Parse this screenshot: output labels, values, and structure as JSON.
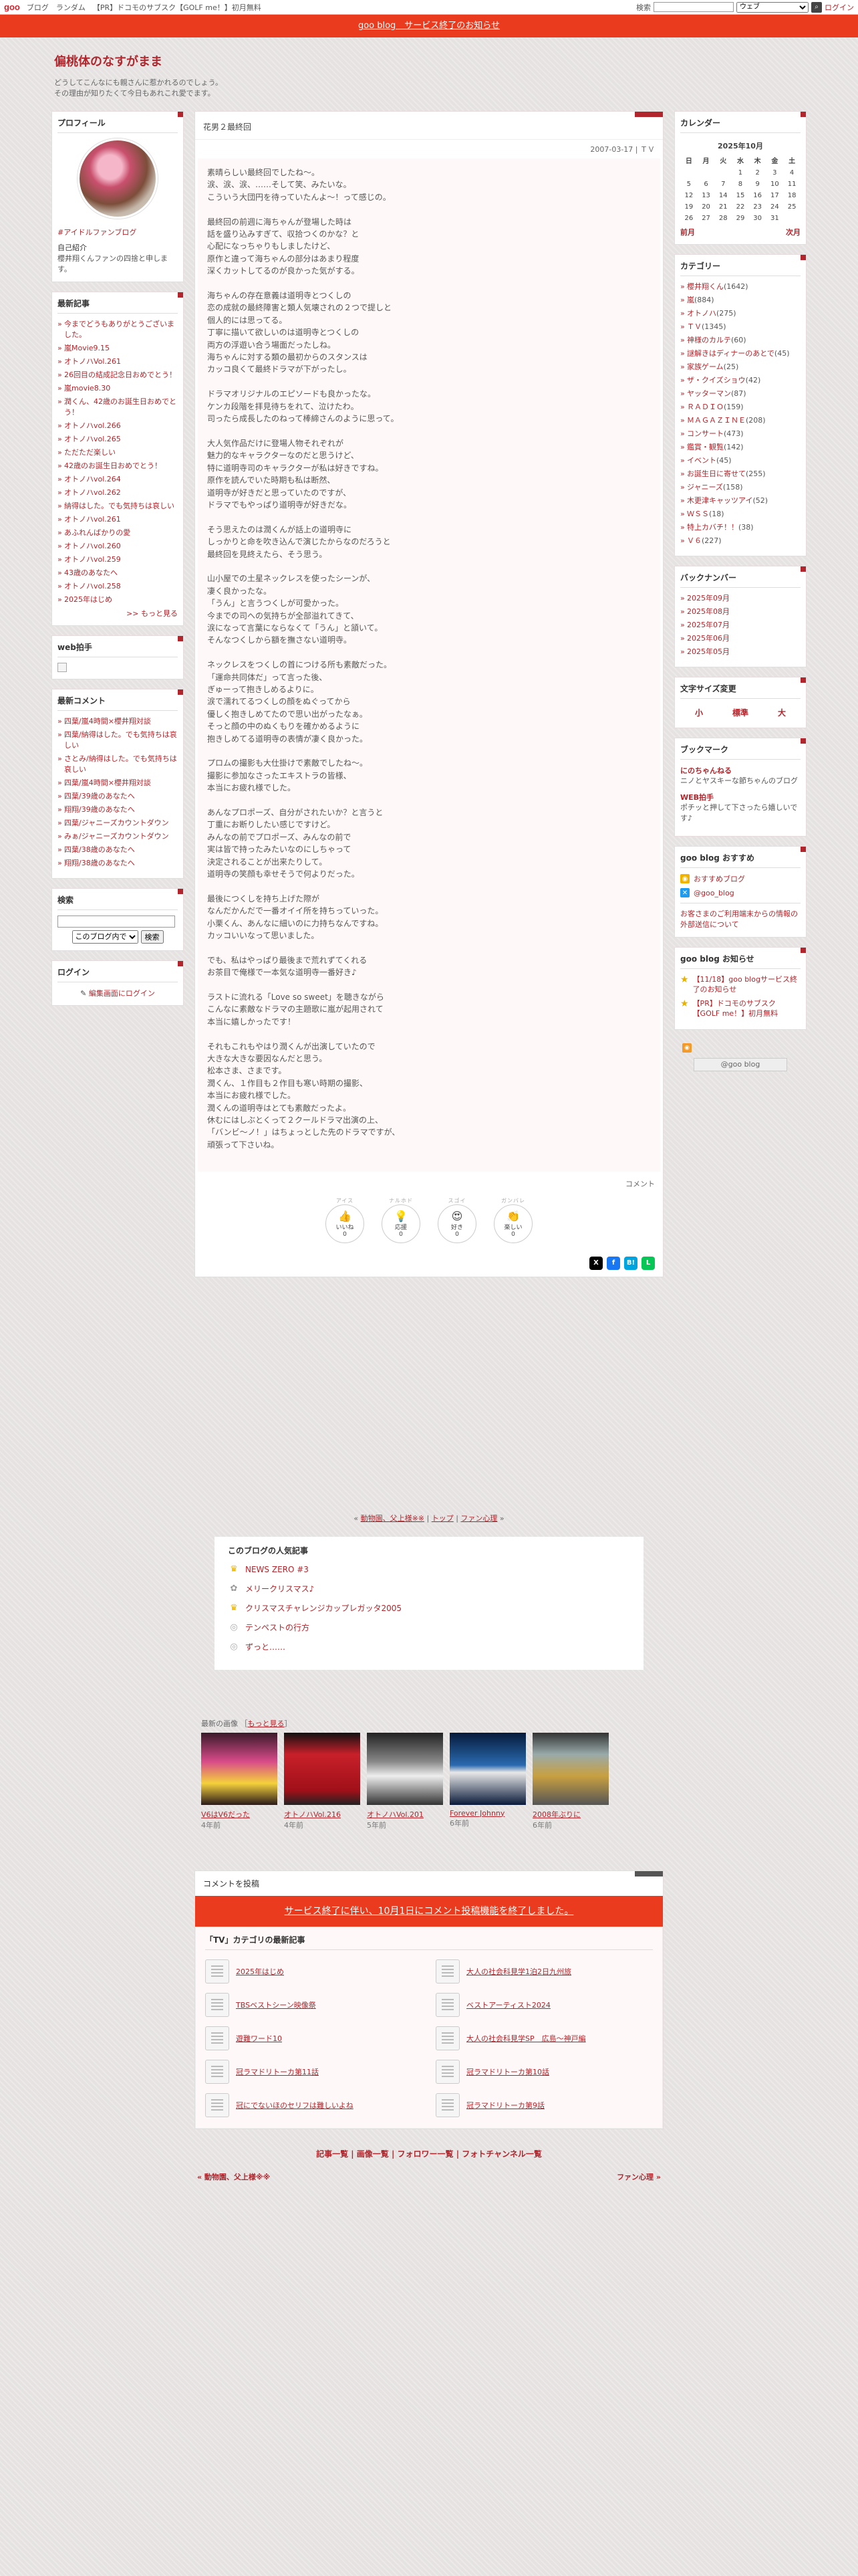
{
  "topbar": {
    "logo": "goo",
    "nav": [
      "ブログ",
      "ランダム",
      "【PR】ドコモのサブスク【GOLF me！】初月無料"
    ],
    "search_label": "検索",
    "select": "ウェブ",
    "login": "ログイン"
  },
  "notice": "goo blog　サービス終了のお知らせ",
  "header": {
    "title": "偏桃体のなすがまま",
    "desc1": "どうしてこんなにも親さんに惹かれるのでしょう。",
    "desc2": "その理由が知りたくて今日もあれこれ愛でます。"
  },
  "profile": {
    "title": "プロフィール",
    "link": "#アイドルファンブログ",
    "intro_label": "自己紹介",
    "intro": "櫻井翔くんファンの四捨と申します。"
  },
  "recent": {
    "title": "最新記事",
    "items": [
      "今までどうもありがとうございました。",
      "嵐Movie9.15",
      "オトノハVol.261",
      "26回目の結成記念日おめでとう！",
      "嵐movie8.30",
      "潤くん、42歳のお誕生日おめでとう！",
      "オトノハvol.266",
      "オトノハvol.265",
      "ただただ楽しい",
      "42歳のお誕生日おめでとう！",
      "オトノハvol.264",
      "オトノハvol.262",
      "納得はした。でも気持ちは哀しい",
      "オトノハvol.261",
      "あふれんばかりの愛",
      "オトノハvol.260",
      "オトノハvol.259",
      "43歳のあなたへ",
      "オトノハvol.258",
      "2025年はじめ"
    ],
    "more": ">> もっと見る"
  },
  "webclap": {
    "title": "web拍手"
  },
  "latest_comments": {
    "title": "最新コメント",
    "items": [
      "四葉/嵐4時間×櫻井翔対談",
      "四葉/納得はした。でも気持ちは哀しい",
      "さとみ/納得はした。でも気持ちは哀しい",
      "四葉/嵐4時間×櫻井翔対談",
      "四葉/39歳のあなたへ",
      "翔翔/39歳のあなたへ",
      "四葉/ジャニーズカウントダウン",
      "みぁ/ジャニーズカウントダウン",
      "四葉/38歳のあなたへ",
      "翔翔/38歳のあなたへ"
    ]
  },
  "search": {
    "title": "検索",
    "select": "このブログ内で",
    "button": "検索"
  },
  "login": {
    "title": "ログイン",
    "link": "編集画面にログイン"
  },
  "article": {
    "title": "花男２最終回",
    "date": "2007-03-17 | ＴＶ",
    "paragraphs": [
      "素晴らしい最終回でしたね〜。\n涙、涙、涙、……そして笑、みたいな。\nこういう大団円を待っていたんよ〜！って感じの。",
      "最終回の前週に海ちゃんが登場した時は\n話を盛り込みすぎて、収拾つくのかな？と\n心配になっちゃりもしましたけど、\n原作と違って海ちゃんの部分はあまり程度\n深くカットしてるのが良かった気がする。",
      "海ちゃんの存在意義は道明寺とつくしの\n恋の成就の最終障害と類人気壊されの２つで提しと\n個人的には思ってる。\n丁寧に描いて欲しいのは道明寺とつくしの\n両方の浮遊い合う場面だったしね。\n海ちゃんに対する類の最初からのスタンスは\nカッコ良くて最終ドラマが下がったし。",
      "ドラマオリジナルのエピソードも良かったな。\nケンカ段階を拝見待ちをれて、泣けたわ。\n司ったら成長したのねって棒締さんのように思って。",
      "大人気作品だけに登場人物それぞれが\n魅力的なキャラクターなのだと思うけど、\n特に道明寺司のキャラクターが私は好きですね。\n原作を読んでいた時期も私は断然、\n道明寺が好きだと思っていたのですが、\nドラマでもやっぱり道明寺が好きだな。",
      "そう思えたのは潤くんが話上の道明寺に\nしっかりと命を吹き込んで演じたからなのだろうと\n最終回を見終えたら、そう思う。",
      "山小屋での土星ネックレスを使ったシーンが、\n凄く良かったな。\n「うん」と言うつくしが可愛かった。\n今までの司への気持ちが全部溢れてきて、\n涙になって言葉にならなくて「うん」と頷いて。\nそんなつくしから額を撫さない道明寺。",
      "ネックレスをつくしの首につける所も素敵だった。\n「運命共同体だ」って言った後、\nぎゅーって抱きしめるよりに。\n涙で濡れてるつくしの顔をぬぐってから\n優しく抱きしめてたので思い出がったなぁ。\nそっと顔の中のぬくもりを確かめるように\n抱きしめてる道明寺の表情が凄く良かった。",
      "プロムの撮影も大仕掛けで素敵でしたね〜。\n撮影に参加なさったエキストラの皆様、\n本当にお疲れ様でした。",
      "あんなプロポーズ、自分がされたいか？と言うと\n丁重にお断りしたい感じですけど。\nみんなの前でプロポーズ、みんなの前で\n実は皆で持ったみたいなのにしちゃって\n決定されることが出来たりして。\n道明寺の笑顔も幸せそうで何よりだった。",
      "最後につくしを持ち上げた際が\nなんだかんだで一番オイイ所を持ちっていった。\n小栗くん、あんなに細いのに力持ちなんですね。\nカッコいいなって思いました。",
      "でも、私はやっぱり最後まで荒れずてくれる\nお茶目で俺様で一本気な道明寺一番好き♪",
      "ラストに流れる「Love so sweet」を聴きながら\nこんなに素敵なドラマの主題歌に嵐が起用されて\n本当に嬉しかったです！",
      "それもこれもやはり潤くんが出演していたので\n大きな大きな要因なんだと思う。\n松本さま、さまです。\n潤くん、１作目も２作目も寒い時期の撮影、\n本当にお疲れ様でした。\n潤くんの道明寺はとても素敵だったよ。\n休むにはしぶとくって２クールドラマ出演の上、\n「バンビ〜ノ！」はちょっとした先のドラマですが、\n頑張って下さいね。"
    ],
    "comment_label": "コメント",
    "reactions": [
      {
        "top": "アイス",
        "e": "👍",
        "lbl": "いいね",
        "n": "0"
      },
      {
        "top": "ナルホド",
        "e": "💡",
        "lbl": "応援",
        "n": "0"
      },
      {
        "top": "スゴイ",
        "e": "😍",
        "lbl": "好き",
        "n": "0"
      },
      {
        "top": "ガンバレ",
        "e": "👏",
        "lbl": "楽しい",
        "n": "0"
      }
    ]
  },
  "pager": {
    "prev": "動物園、父上様※※",
    "top": "トップ",
    "next": "ファン心理"
  },
  "popular": {
    "title": "このブログの人気記事",
    "items": [
      "NEWS ZERO #3",
      "メリークリスマス♪",
      "クリスマスチャレンジカップレガッタ2005",
      "テンペストの行方",
      "ずっと……"
    ]
  },
  "images": {
    "header": "最新の画像",
    "more": "もっと見る",
    "items": [
      {
        "cap": "V6はV6だった",
        "age": "4年前"
      },
      {
        "cap": "オトノハVol.216",
        "age": "4年前"
      },
      {
        "cap": "オトノハVol.201",
        "age": "5年前"
      },
      {
        "cap": "Forever Johnny",
        "age": "6年前"
      },
      {
        "cap": "2008年ぶりに",
        "age": "6年前"
      }
    ]
  },
  "comment_post": {
    "title": "コメントを投稿",
    "notice": "サービス終了に伴い、10月1日にコメント投稿機能を終了しました。"
  },
  "cat_latest": {
    "title": "「TV」カテゴリの最新記事",
    "items": [
      "2025年はじめ",
      "大人の社会科見学1泊2日九州旅",
      "TBSベストシーン映像祭",
      "ベストアーティスト2024",
      "遊難ワード10",
      "大人の社会科見学SP　広島〜神戸編",
      "冠ラマドリトーカ第11話",
      "冠ラマドリトーカ第10話",
      "冠にでないほのセリフは難しいよね",
      "冠ラマドリトーカ第9話"
    ]
  },
  "footer": {
    "links": "記事一覧 | 画像一覧 | フォロワー一覧 | フォトチャンネル一覧",
    "prev": "« 動物園、父上様※※",
    "next": "ファン心理 »"
  },
  "calendar": {
    "title": "カレンダー",
    "month": "2025年10月",
    "dows": [
      "日",
      "月",
      "火",
      "水",
      "木",
      "金",
      "土"
    ],
    "weeks": [
      [
        "",
        "",
        "",
        "1",
        "2",
        "3",
        "4"
      ],
      [
        "5",
        "6",
        "7",
        "8",
        "9",
        "10",
        "11"
      ],
      [
        "12",
        "13",
        "14",
        "15",
        "16",
        "17",
        "18"
      ],
      [
        "19",
        "20",
        "21",
        "22",
        "23",
        "24",
        "25"
      ],
      [
        "26",
        "27",
        "28",
        "29",
        "30",
        "31",
        ""
      ]
    ],
    "prev": "前月",
    "next": "次月"
  },
  "categories": {
    "title": "カテゴリー",
    "items": [
      {
        "n": "櫻井翔くん",
        "c": "(1642)"
      },
      {
        "n": "嵐",
        "c": "(884)"
      },
      {
        "n": "オトノハ",
        "c": "(275)"
      },
      {
        "n": "ＴＶ",
        "c": "(1345)"
      },
      {
        "n": "神様のカルテ",
        "c": "(60)"
      },
      {
        "n": "謎解きはディナーのあとで",
        "c": "(45)"
      },
      {
        "n": "家族ゲーム",
        "c": "(25)"
      },
      {
        "n": "ザ・クイズショウ",
        "c": "(42)"
      },
      {
        "n": "ヤッターマン",
        "c": "(87)"
      },
      {
        "n": "ＲＡＤＩＯ",
        "c": "(159)"
      },
      {
        "n": "ＭＡＧＡＺＩＮＥ",
        "c": "(208)"
      },
      {
        "n": "コンサート",
        "c": "(473)"
      },
      {
        "n": "鑑賞・観覧",
        "c": "(142)"
      },
      {
        "n": "イベント",
        "c": "(45)"
      },
      {
        "n": "お誕生日に寄せて",
        "c": "(255)"
      },
      {
        "n": "ジャニーズ",
        "c": "(158)"
      },
      {
        "n": "木更津キャッツアイ",
        "c": "(52)"
      },
      {
        "n": "ＷＳＳ",
        "c": "(18)"
      },
      {
        "n": "特上カバチ！！",
        "c": "(38)"
      },
      {
        "n": "Ｖ６",
        "c": "(227)"
      }
    ]
  },
  "backnumber": {
    "title": "バックナンバー",
    "items": [
      "2025年09月",
      "2025年08月",
      "2025年07月",
      "2025年06月",
      "2025年05月"
    ]
  },
  "fontsize": {
    "title": "文字サイズ変更",
    "items": [
      "小",
      "標準",
      "大"
    ]
  },
  "bookmark": {
    "title": "ブックマーク",
    "items": [
      {
        "t": "にのちゃんねる",
        "d": "ニノとヤスキーな節ちゃんのブログ"
      },
      {
        "t": "WEB拍手",
        "d": "ポチッと押して下さったら嬉しいです♪"
      }
    ]
  },
  "goo_recommend": {
    "title": "goo blog おすすめ",
    "items": [
      "おすすめブログ",
      "@goo_blog"
    ],
    "notice": "お客さまのご利用端末からの情報の外部送信について"
  },
  "goo_notice": {
    "title": "goo blog お知らせ",
    "items": [
      "【11/18】goo blogサービス終了のお知らせ",
      "【PR】ドコモのサブスク【GOLF me！】初月無料"
    ],
    "footer": "@goo blog"
  },
  "colors": {
    "accent": "#b0262c",
    "notice_bg": "#ea3b1e"
  }
}
